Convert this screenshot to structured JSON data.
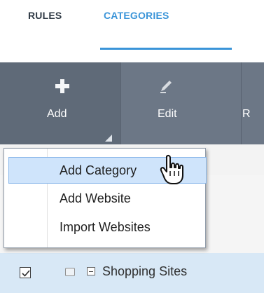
{
  "tabs": [
    {
      "label": "RULES"
    },
    {
      "label": "CATEGORIES"
    }
  ],
  "toolbar": {
    "add_label": "Add",
    "edit_label": "Edit",
    "third_label": "R"
  },
  "dropdown_menu": {
    "items": [
      {
        "label": "Add Category"
      },
      {
        "label": "Add Website"
      },
      {
        "label": "Import Websites"
      }
    ]
  },
  "category_row": {
    "label": "Shopping Sites"
  }
}
